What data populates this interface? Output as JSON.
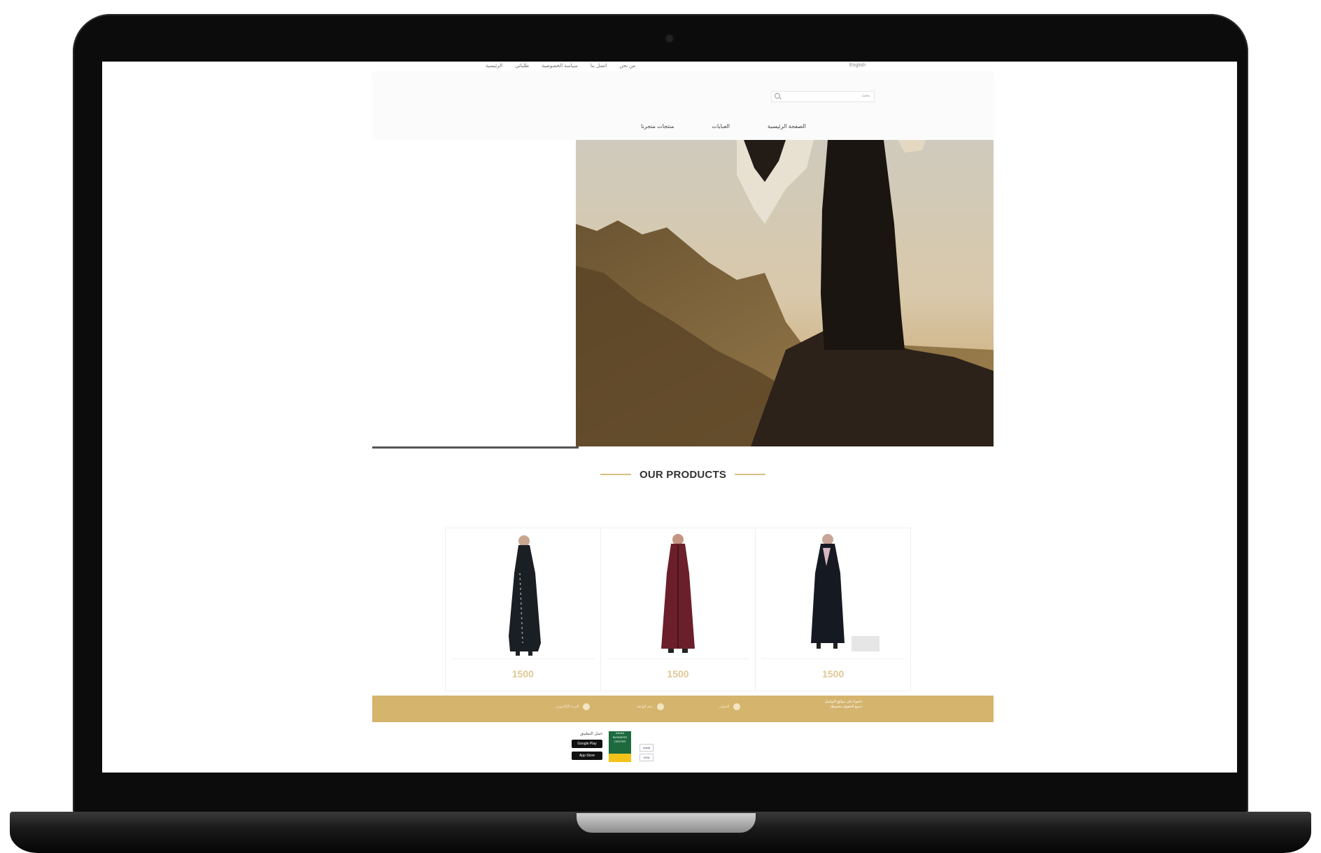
{
  "topbar": {
    "links": [
      "الرئيسية",
      "طلباتي",
      "سياسة الخصوصية",
      "اتصل بنا",
      "من نحن"
    ],
    "language": "English"
  },
  "header": {
    "search_placeholder": "",
    "search_label": "بحث",
    "nav": [
      "الصفحة الرئيسية",
      "العبايات",
      "منتجات متجرنا"
    ]
  },
  "products_section": {
    "title": "OUR PRODUCTS",
    "items": [
      {
        "price": "1500",
        "color": "#1a1f24"
      },
      {
        "price": "1500",
        "color": "#6a1f2a"
      },
      {
        "price": "1500",
        "color": "#151a22"
      }
    ]
  },
  "footer_bar": {
    "items": [
      "البريد الإلكتروني",
      "رقم الهاتف",
      "العنوان"
    ],
    "contact": [
      "تابعونا على مواقع التواصل",
      "جميع الحقوق محفوظة"
    ]
  },
  "bottom": {
    "download_label": "حمل التطبيق",
    "stores": [
      "Google Play",
      "App Store"
    ],
    "cert": "SAUDI BUSINESS CENTER",
    "payments": [
      "mada",
      "VISA"
    ]
  },
  "colors": {
    "accent_gold": "#d5b46e",
    "price_gold": "#e0c894"
  }
}
